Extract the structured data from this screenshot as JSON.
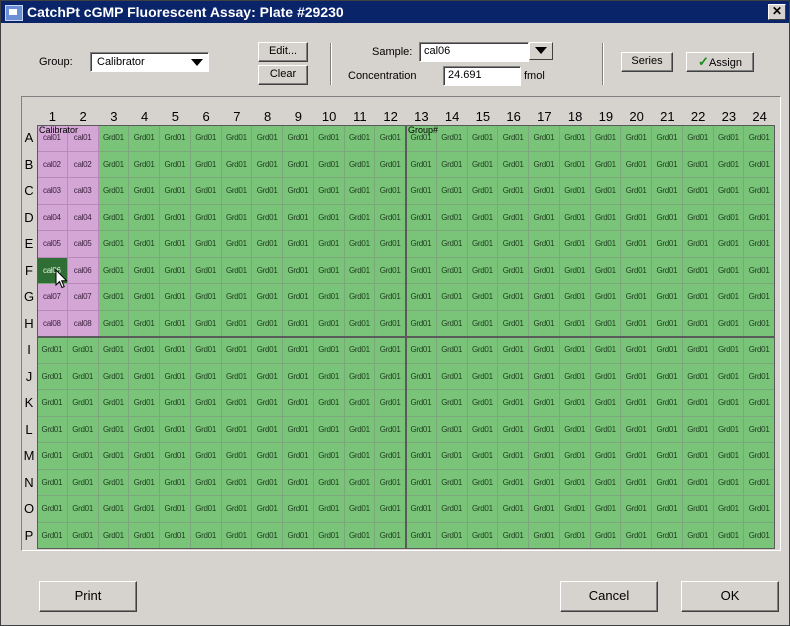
{
  "window": {
    "title": "CatchPt cGMP Fluorescent Assay: Plate #29230"
  },
  "toolbar": {
    "group_label": "Group:",
    "group_value": "Calibrator",
    "edit_label": "Edit...",
    "clear_label": "Clear",
    "sample_label": "Sample:",
    "sample_value": "cal06",
    "concentration_label": "Concentration",
    "concentration_value": "24.691",
    "concentration_unit": "fmol",
    "series_label": "Series",
    "assign_label": "Assign"
  },
  "plate": {
    "columns": [
      "1",
      "2",
      "3",
      "4",
      "5",
      "6",
      "7",
      "8",
      "9",
      "10",
      "11",
      "12",
      "13",
      "14",
      "15",
      "16",
      "17",
      "18",
      "19",
      "20",
      "21",
      "22",
      "23",
      "24"
    ],
    "rows": [
      "A",
      "B",
      "C",
      "D",
      "E",
      "F",
      "G",
      "H",
      "I",
      "J",
      "K",
      "L",
      "M",
      "N",
      "O",
      "P"
    ],
    "default_cell": "Grd01",
    "calibrator_group_label": "Calibrator",
    "group2_label": "Group#",
    "calibrator_cells": [
      [
        "cal01",
        "cal01"
      ],
      [
        "cal02",
        "cal02"
      ],
      [
        "cal03",
        "cal03"
      ],
      [
        "cal04",
        "cal04"
      ],
      [
        "cal05",
        "cal05"
      ],
      [
        "cal06",
        "cal06"
      ],
      [
        "cal07",
        "cal07"
      ],
      [
        "cal08",
        "cal08"
      ]
    ],
    "selected_cell": {
      "row": "F",
      "column": "1"
    },
    "colors": {
      "group_green": "#79c479",
      "calibrator_purple": "#d3a6d6",
      "selected": "#2f6f36"
    }
  },
  "buttons": {
    "print_label": "Print",
    "cancel_label": "Cancel",
    "ok_label": "OK"
  }
}
